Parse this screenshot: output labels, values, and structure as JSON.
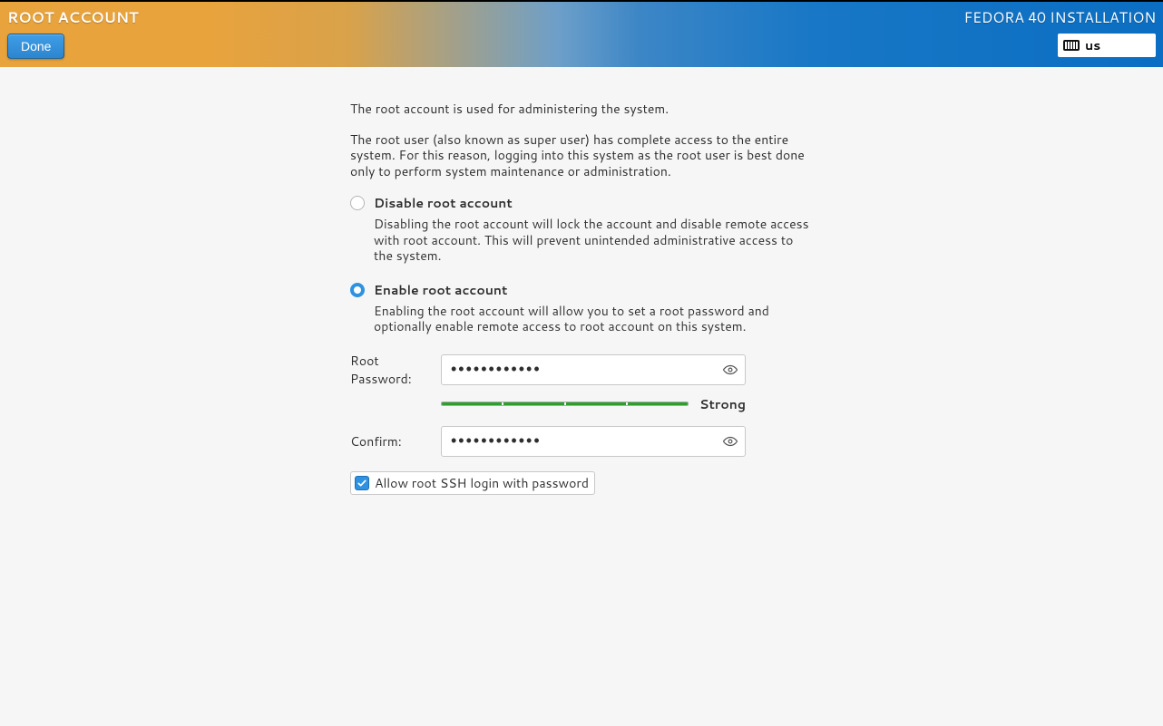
{
  "header": {
    "page_title": "ROOT ACCOUNT",
    "done_label": "Done",
    "installer_label": "FEDORA 40 INSTALLATION",
    "keyboard_layout": "us"
  },
  "intro": {
    "line1": "The root account is used for administering the system.",
    "line2": "The root user (also known as super user) has complete access to the entire system. For this reason, logging into this system as the root user is best done only to perform system maintenance or administration."
  },
  "options": {
    "disable": {
      "title": "Disable root account",
      "desc": "Disabling the root account will lock the account and disable remote access with root account. This will prevent unintended administrative access to the system.",
      "selected": false
    },
    "enable": {
      "title": "Enable root account",
      "desc": "Enabling the root account will allow you to set a root password and optionally enable remote access to root account on this system.",
      "selected": true
    }
  },
  "form": {
    "password_label": "Root Password:",
    "password_value": "••••••••••••",
    "confirm_label": "Confirm:",
    "confirm_value": "••••••••••••",
    "strength_label": "Strong",
    "ssh_label": "Allow root SSH login with password",
    "ssh_checked": true
  }
}
